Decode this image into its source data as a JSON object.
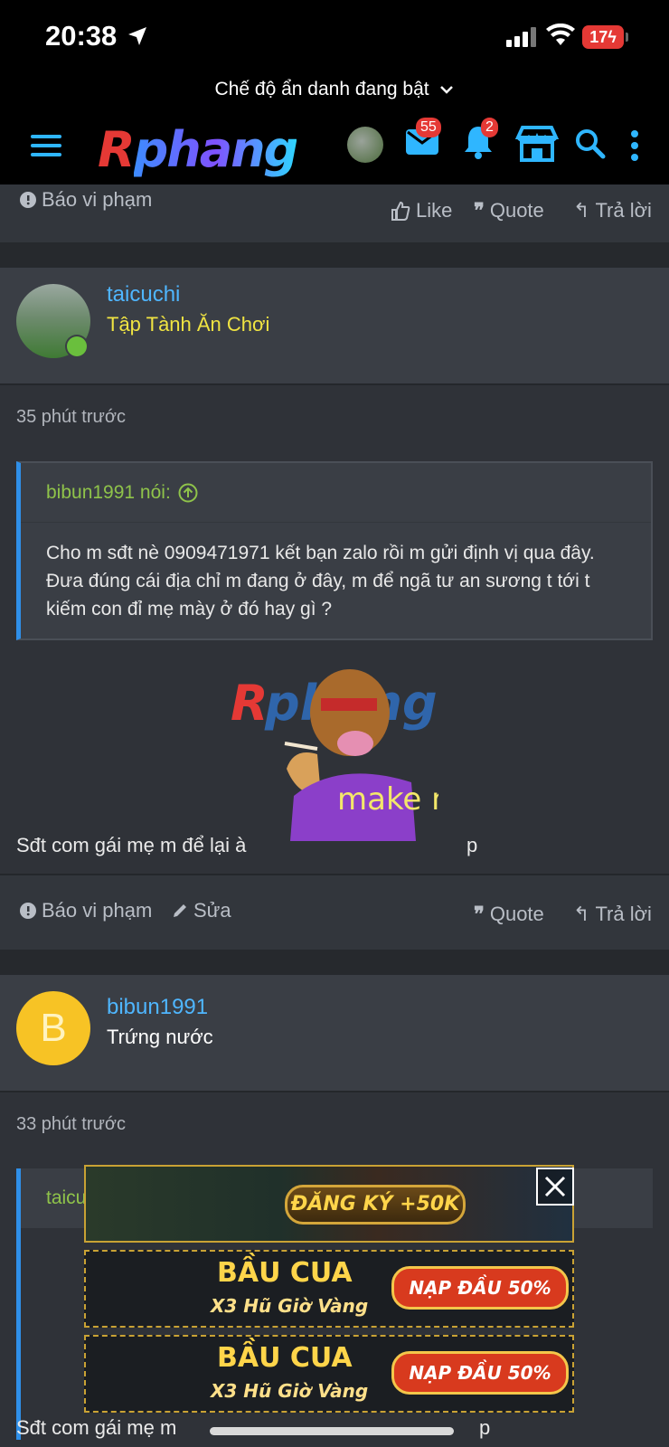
{
  "status_bar": {
    "time": "20:38",
    "battery": "17"
  },
  "incognito": {
    "label": "Chế độ ẩn danh đang bật"
  },
  "header": {
    "logo_r": "R",
    "logo_rest": "phang",
    "messages_badge": "55",
    "alerts_badge": "2"
  },
  "post_prev_actions": {
    "report": "Báo vi phạm",
    "like": "Like",
    "quote": "Quote",
    "reply": "Trả lời"
  },
  "post1": {
    "username": "taicuchi",
    "user_title": "Tập Tành Ăn Chơi",
    "time": "35 phút trước",
    "quote_author": "bibun1991 nói:",
    "quote_text": "Cho m sđt nè 0909471971 kết bạn zalo rồi m gửi định vị qua đây. Đưa đúng cái địa chỉ m đang ở đây, m để ngã tư an sương t tới t kiếm con đỉ mẹ mày ở đó hay gì ?",
    "message_left": "Sđt com gái mẹ m để lại à",
    "message_right": "p",
    "sticker_text": "make me",
    "actions": {
      "report": "Báo vi phạm",
      "edit": "Sửa",
      "quote": "Quote",
      "reply": "Trả lời"
    }
  },
  "post2": {
    "avatar_letter": "B",
    "username": "bibun1991",
    "user_title": "Trứng nước",
    "time": "33 phút trước",
    "quote_author": "taicuchi nói:",
    "message_left": "Sđt com gái mẹ m",
    "message_right": "p"
  },
  "ads": {
    "banner1": "ĐĂNG KÝ +50K",
    "banner2_left": "BẦU CUA",
    "banner2_sub": "X3 Hũ Giờ Vàng",
    "banner2_right": "NẠP ĐẦU 50%",
    "banner3_left": "BẦU CUA",
    "banner3_sub": "X3 Hũ Giờ Vàng",
    "banner3_right": "NẠP ĐẦU 50%"
  },
  "colors": {
    "link": "#4fb6ff",
    "title_gold": "#f0e442",
    "quote_author": "#8fc34a",
    "accent": "#2f8fe8",
    "badge": "#e53935"
  }
}
